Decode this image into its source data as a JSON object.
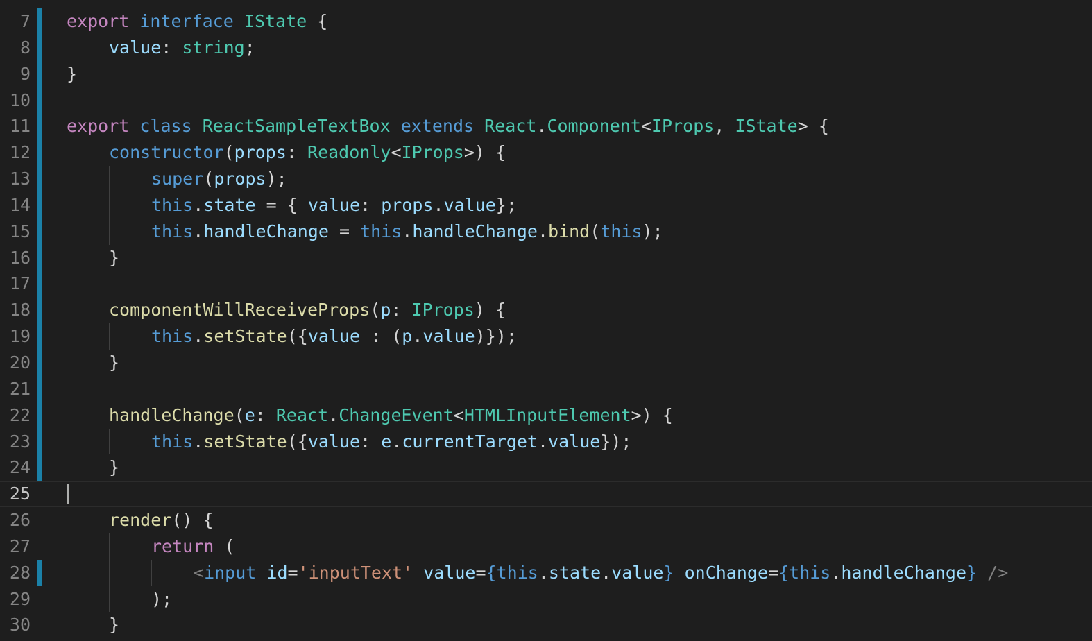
{
  "editor": {
    "active_line": 25,
    "modified_lines": [
      7,
      8,
      9,
      10,
      11,
      12,
      13,
      14,
      15,
      16,
      17,
      18,
      19,
      20,
      21,
      22,
      23,
      24,
      28
    ],
    "colors": {
      "background": "#1e1e1e",
      "keyword": "#c586c0",
      "storage": "#569cd6",
      "type": "#4ec9b0",
      "function": "#dcdcaa",
      "variable": "#9cdcfe",
      "string": "#ce9178",
      "line_number": "#858585",
      "modified_marker": "#1b81a8"
    },
    "lines": [
      {
        "n": "7",
        "indent": 0,
        "tokens": [
          {
            "t": "export",
            "c": "kw"
          },
          {
            "t": " ",
            "c": "pu"
          },
          {
            "t": "interface",
            "c": "st"
          },
          {
            "t": " ",
            "c": "pu"
          },
          {
            "t": "IState",
            "c": "ty"
          },
          {
            "t": " {",
            "c": "pu"
          }
        ]
      },
      {
        "n": "8",
        "indent": 1,
        "tokens": [
          {
            "t": "value",
            "c": "vr"
          },
          {
            "t": ": ",
            "c": "pu"
          },
          {
            "t": "string",
            "c": "ty"
          },
          {
            "t": ";",
            "c": "pu"
          }
        ]
      },
      {
        "n": "9",
        "indent": 0,
        "tokens": [
          {
            "t": "}",
            "c": "pu"
          }
        ]
      },
      {
        "n": "10",
        "indent": 0,
        "tokens": []
      },
      {
        "n": "11",
        "indent": 0,
        "tokens": [
          {
            "t": "export",
            "c": "kw"
          },
          {
            "t": " ",
            "c": "pu"
          },
          {
            "t": "class",
            "c": "st"
          },
          {
            "t": " ",
            "c": "pu"
          },
          {
            "t": "ReactSampleTextBox",
            "c": "ty"
          },
          {
            "t": " ",
            "c": "pu"
          },
          {
            "t": "extends",
            "c": "st"
          },
          {
            "t": " ",
            "c": "pu"
          },
          {
            "t": "React",
            "c": "ty"
          },
          {
            "t": ".",
            "c": "pu"
          },
          {
            "t": "Component",
            "c": "ty"
          },
          {
            "t": "<",
            "c": "pu"
          },
          {
            "t": "IProps",
            "c": "ty"
          },
          {
            "t": ", ",
            "c": "pu"
          },
          {
            "t": "IState",
            "c": "ty"
          },
          {
            "t": "> {",
            "c": "pu"
          }
        ]
      },
      {
        "n": "12",
        "indent": 1,
        "tokens": [
          {
            "t": "constructor",
            "c": "st"
          },
          {
            "t": "(",
            "c": "pu"
          },
          {
            "t": "props",
            "c": "vr"
          },
          {
            "t": ": ",
            "c": "pu"
          },
          {
            "t": "Readonly",
            "c": "ty"
          },
          {
            "t": "<",
            "c": "pu"
          },
          {
            "t": "IProps",
            "c": "ty"
          },
          {
            "t": ">) {",
            "c": "pu"
          }
        ]
      },
      {
        "n": "13",
        "indent": 2,
        "tokens": [
          {
            "t": "super",
            "c": "st"
          },
          {
            "t": "(",
            "c": "pu"
          },
          {
            "t": "props",
            "c": "vr"
          },
          {
            "t": ");",
            "c": "pu"
          }
        ]
      },
      {
        "n": "14",
        "indent": 2,
        "tokens": [
          {
            "t": "this",
            "c": "st"
          },
          {
            "t": ".",
            "c": "pu"
          },
          {
            "t": "state",
            "c": "vr"
          },
          {
            "t": " = { ",
            "c": "pu"
          },
          {
            "t": "value",
            "c": "vr"
          },
          {
            "t": ": ",
            "c": "pu"
          },
          {
            "t": "props",
            "c": "vr"
          },
          {
            "t": ".",
            "c": "pu"
          },
          {
            "t": "value",
            "c": "vr"
          },
          {
            "t": "};",
            "c": "pu"
          }
        ]
      },
      {
        "n": "15",
        "indent": 2,
        "tokens": [
          {
            "t": "this",
            "c": "st"
          },
          {
            "t": ".",
            "c": "pu"
          },
          {
            "t": "handleChange",
            "c": "vr"
          },
          {
            "t": " = ",
            "c": "pu"
          },
          {
            "t": "this",
            "c": "st"
          },
          {
            "t": ".",
            "c": "pu"
          },
          {
            "t": "handleChange",
            "c": "vr"
          },
          {
            "t": ".",
            "c": "pu"
          },
          {
            "t": "bind",
            "c": "fn"
          },
          {
            "t": "(",
            "c": "pu"
          },
          {
            "t": "this",
            "c": "st"
          },
          {
            "t": ");",
            "c": "pu"
          }
        ]
      },
      {
        "n": "16",
        "indent": 1,
        "tokens": [
          {
            "t": "}",
            "c": "pu"
          }
        ]
      },
      {
        "n": "17",
        "indent": 1,
        "tokens": []
      },
      {
        "n": "18",
        "indent": 1,
        "tokens": [
          {
            "t": "componentWillReceiveProps",
            "c": "fn"
          },
          {
            "t": "(",
            "c": "pu"
          },
          {
            "t": "p",
            "c": "vr"
          },
          {
            "t": ": ",
            "c": "pu"
          },
          {
            "t": "IProps",
            "c": "ty"
          },
          {
            "t": ") {",
            "c": "pu"
          }
        ]
      },
      {
        "n": "19",
        "indent": 2,
        "tokens": [
          {
            "t": "this",
            "c": "st"
          },
          {
            "t": ".",
            "c": "pu"
          },
          {
            "t": "setState",
            "c": "fn"
          },
          {
            "t": "({",
            "c": "pu"
          },
          {
            "t": "value",
            "c": "vr"
          },
          {
            "t": " : (",
            "c": "pu"
          },
          {
            "t": "p",
            "c": "vr"
          },
          {
            "t": ".",
            "c": "pu"
          },
          {
            "t": "value",
            "c": "vr"
          },
          {
            "t": ")});",
            "c": "pu"
          }
        ]
      },
      {
        "n": "20",
        "indent": 1,
        "tokens": [
          {
            "t": "}",
            "c": "pu"
          }
        ]
      },
      {
        "n": "21",
        "indent": 1,
        "tokens": []
      },
      {
        "n": "22",
        "indent": 1,
        "tokens": [
          {
            "t": "handleChange",
            "c": "fn"
          },
          {
            "t": "(",
            "c": "pu"
          },
          {
            "t": "e",
            "c": "vr"
          },
          {
            "t": ": ",
            "c": "pu"
          },
          {
            "t": "React",
            "c": "ty"
          },
          {
            "t": ".",
            "c": "pu"
          },
          {
            "t": "ChangeEvent",
            "c": "ty"
          },
          {
            "t": "<",
            "c": "pu"
          },
          {
            "t": "HTMLInputElement",
            "c": "ty"
          },
          {
            "t": ">) {",
            "c": "pu"
          }
        ]
      },
      {
        "n": "23",
        "indent": 2,
        "tokens": [
          {
            "t": "this",
            "c": "st"
          },
          {
            "t": ".",
            "c": "pu"
          },
          {
            "t": "setState",
            "c": "fn"
          },
          {
            "t": "({",
            "c": "pu"
          },
          {
            "t": "value",
            "c": "vr"
          },
          {
            "t": ": ",
            "c": "pu"
          },
          {
            "t": "e",
            "c": "vr"
          },
          {
            "t": ".",
            "c": "pu"
          },
          {
            "t": "currentTarget",
            "c": "vr"
          },
          {
            "t": ".",
            "c": "pu"
          },
          {
            "t": "value",
            "c": "vr"
          },
          {
            "t": "});",
            "c": "pu"
          }
        ]
      },
      {
        "n": "24",
        "indent": 1,
        "tokens": [
          {
            "t": "}",
            "c": "pu"
          }
        ]
      },
      {
        "n": "25",
        "indent": 0,
        "tokens": []
      },
      {
        "n": "26",
        "indent": 1,
        "tokens": [
          {
            "t": "render",
            "c": "fn"
          },
          {
            "t": "() {",
            "c": "pu"
          }
        ]
      },
      {
        "n": "27",
        "indent": 2,
        "tokens": [
          {
            "t": "return",
            "c": "kw"
          },
          {
            "t": " (",
            "c": "pu"
          }
        ]
      },
      {
        "n": "28",
        "indent": 3,
        "tokens": [
          {
            "t": "<",
            "c": "tag"
          },
          {
            "t": "input",
            "c": "st"
          },
          {
            "t": " ",
            "c": "pu"
          },
          {
            "t": "id",
            "c": "vr"
          },
          {
            "t": "=",
            "c": "pu"
          },
          {
            "t": "'inputText'",
            "c": "str"
          },
          {
            "t": " ",
            "c": "pu"
          },
          {
            "t": "value",
            "c": "vr"
          },
          {
            "t": "=",
            "c": "pu"
          },
          {
            "t": "{",
            "c": "st"
          },
          {
            "t": "this",
            "c": "st"
          },
          {
            "t": ".",
            "c": "pu"
          },
          {
            "t": "state",
            "c": "vr"
          },
          {
            "t": ".",
            "c": "pu"
          },
          {
            "t": "value",
            "c": "vr"
          },
          {
            "t": "}",
            "c": "st"
          },
          {
            "t": " ",
            "c": "pu"
          },
          {
            "t": "onChange",
            "c": "vr"
          },
          {
            "t": "=",
            "c": "pu"
          },
          {
            "t": "{",
            "c": "st"
          },
          {
            "t": "this",
            "c": "st"
          },
          {
            "t": ".",
            "c": "pu"
          },
          {
            "t": "handleChange",
            "c": "vr"
          },
          {
            "t": "}",
            "c": "st"
          },
          {
            "t": " />",
            "c": "tag"
          }
        ]
      },
      {
        "n": "29",
        "indent": 2,
        "tokens": [
          {
            "t": ");",
            "c": "pu"
          }
        ]
      },
      {
        "n": "30",
        "indent": 1,
        "tokens": [
          {
            "t": "}",
            "c": "pu"
          }
        ]
      }
    ]
  }
}
